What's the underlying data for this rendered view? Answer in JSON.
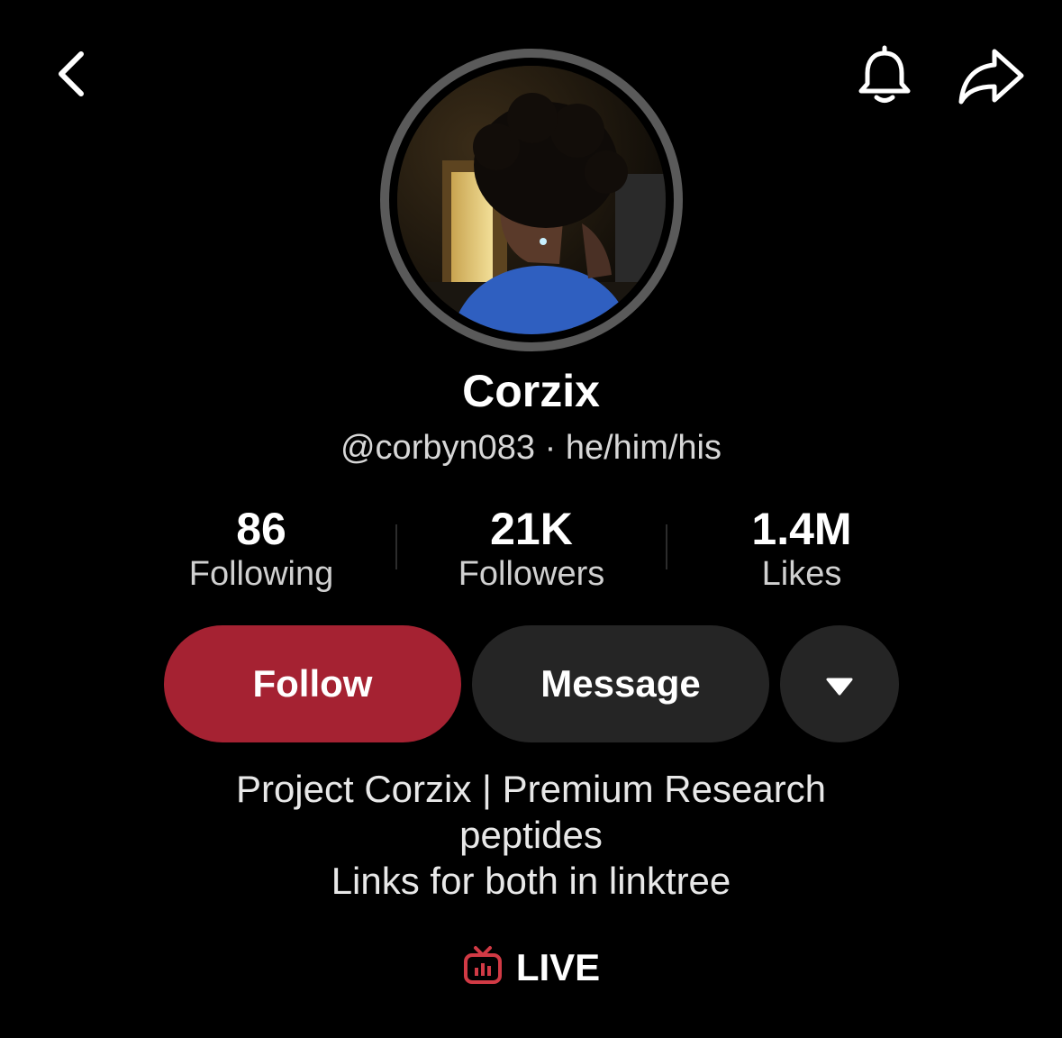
{
  "colors": {
    "background": "#000000",
    "follow_button": "#a52232",
    "secondary_button": "#252525",
    "live_accent": "#d13a45",
    "avatar_ring": "#5a5a5a"
  },
  "icons": {
    "back": "chevron-left-icon",
    "notifications": "bell-icon",
    "share": "share-arrow-icon",
    "more": "caret-down-icon",
    "live": "tv-live-icon"
  },
  "profile": {
    "display_name": "Corzix",
    "handle": "@corbyn083",
    "separator": "·",
    "pronouns": "he/him/his"
  },
  "stats": [
    {
      "value": "86",
      "label": "Following"
    },
    {
      "value": "21K",
      "label": "Followers"
    },
    {
      "value": "1.4M",
      "label": "Likes"
    }
  ],
  "actions": {
    "follow_label": "Follow",
    "message_label": "Message"
  },
  "bio": {
    "lines": [
      "Project Corzix | Premium Research",
      "peptides",
      "Links for both in linktree"
    ]
  },
  "live": {
    "label": "LIVE"
  }
}
